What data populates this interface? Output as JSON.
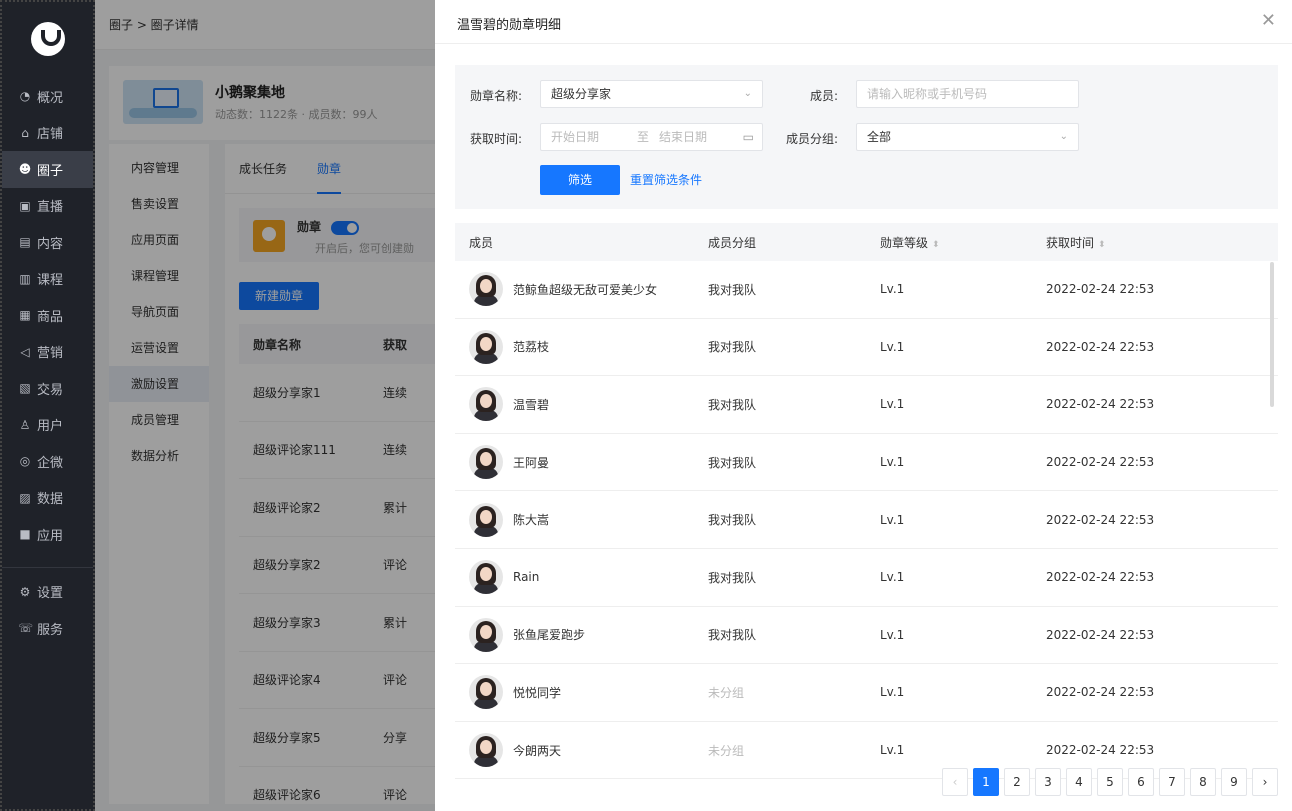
{
  "nav": {
    "items": [
      {
        "label": "概况",
        "icon": "◔"
      },
      {
        "label": "店铺",
        "icon": "⌂"
      },
      {
        "label": "圈子",
        "icon": "☻"
      },
      {
        "label": "直播",
        "icon": "▣"
      },
      {
        "label": "内容",
        "icon": "▤"
      },
      {
        "label": "课程",
        "icon": "▥"
      },
      {
        "label": "商品",
        "icon": "▦"
      },
      {
        "label": "营销",
        "icon": "◁"
      },
      {
        "label": "交易",
        "icon": "▧"
      },
      {
        "label": "用户",
        "icon": "♙"
      },
      {
        "label": "企微",
        "icon": "◎"
      },
      {
        "label": "数据",
        "icon": "▨"
      },
      {
        "label": "应用",
        "icon": "■"
      }
    ],
    "bottom": [
      {
        "label": "设置",
        "icon": "⚙"
      },
      {
        "label": "服务",
        "icon": "☏"
      }
    ]
  },
  "background": {
    "breadcrumb": "圈子 > 圈子详情",
    "circle_name": "小鹅聚集地",
    "circle_stats": "动态数：1122条 · 成员数：99人",
    "side_menu": [
      "内容管理",
      "售卖设置",
      "应用页面",
      "课程管理",
      "导航页面",
      "运营设置",
      "激励设置",
      "成员管理",
      "数据分析"
    ],
    "tabs": [
      "成长任务",
      "勋章"
    ],
    "badge_title": "勋章",
    "badge_desc": "开启后，您可创建勋",
    "new_button": "新建勋章",
    "table_headers": [
      "勋章名称",
      "获取"
    ],
    "rows": [
      [
        "超级分享家1",
        "连续"
      ],
      [
        "超级评论家111",
        "连续"
      ],
      [
        "超级评论家2",
        "累计"
      ],
      [
        "超级分享家2",
        "评论"
      ],
      [
        "超级分享家3",
        "累计"
      ],
      [
        "超级评论家4",
        "评论"
      ],
      [
        "超级分享家5",
        "分享"
      ],
      [
        "超级评论家6",
        "评论"
      ]
    ]
  },
  "drawer": {
    "title": "温雪碧的勋章明细",
    "filters": {
      "badge_name_label": "勋章名称:",
      "badge_name_value": "超级分享家",
      "member_label": "成员:",
      "member_placeholder": "请输入昵称或手机号码",
      "time_label": "获取时间:",
      "date_start": "开始日期",
      "date_sep": "至",
      "date_end": "结束日期",
      "group_label": "成员分组:",
      "group_value": "全部",
      "filter_button": "筛选",
      "reset_link": "重置筛选条件"
    },
    "table": {
      "headers": [
        "成员",
        "成员分组",
        "勋章等级",
        "获取时间"
      ],
      "rows": [
        {
          "name": "范鲸鱼超级无敌可爱美少女",
          "group": "我对我队",
          "level": "Lv.1",
          "time": "2022-02-24 22:53"
        },
        {
          "name": "范荔枝",
          "group": "我对我队",
          "level": "Lv.1",
          "time": "2022-02-24 22:53"
        },
        {
          "name": "温雪碧",
          "group": "我对我队",
          "level": "Lv.1",
          "time": "2022-02-24 22:53"
        },
        {
          "name": "王阿曼",
          "group": "我对我队",
          "level": "Lv.1",
          "time": "2022-02-24 22:53"
        },
        {
          "name": "陈大嵩",
          "group": "我对我队",
          "level": "Lv.1",
          "time": "2022-02-24 22:53"
        },
        {
          "name": "Rain",
          "group": "我对我队",
          "level": "Lv.1",
          "time": "2022-02-24 22:53"
        },
        {
          "name": "张鱼尾爱跑步",
          "group": "我对我队",
          "level": "Lv.1",
          "time": "2022-02-24 22:53"
        },
        {
          "name": "悦悦同学",
          "group": "未分组",
          "level": "Lv.1",
          "time": "2022-02-24 22:53"
        },
        {
          "name": "今朗两天",
          "group": "未分组",
          "level": "Lv.1",
          "time": "2022-02-24 22:53"
        }
      ]
    },
    "pagination": {
      "prev": "‹",
      "next": "›",
      "pages": [
        "1",
        "2",
        "3",
        "4",
        "5",
        "6",
        "7",
        "8",
        "9"
      ],
      "current": "1"
    }
  },
  "colors": {
    "accent": "#1677ff",
    "nav_bg": "#1f2229"
  }
}
